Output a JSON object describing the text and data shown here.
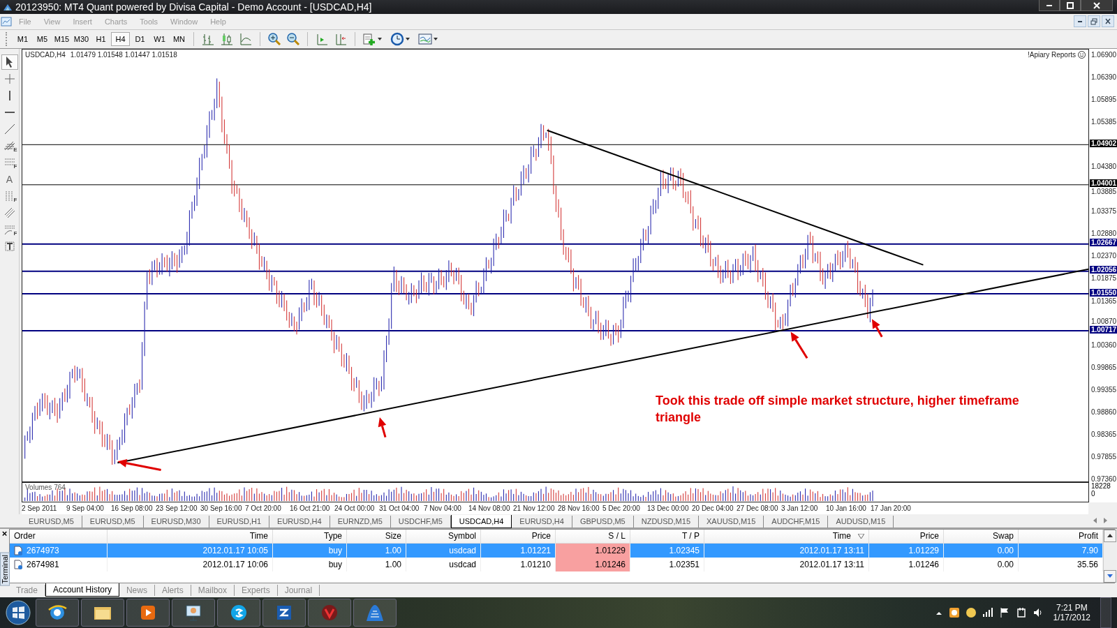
{
  "window": {
    "title": "20123950: MT4 Quant powered by Divisa Capital - Demo Account - [USDCAD,H4]"
  },
  "menu": [
    "File",
    "View",
    "Insert",
    "Charts",
    "Tools",
    "Window",
    "Help"
  ],
  "timeframes": [
    {
      "label": "M1",
      "selected": false
    },
    {
      "label": "M5",
      "selected": false
    },
    {
      "label": "M15",
      "selected": false
    },
    {
      "label": "M30",
      "selected": false
    },
    {
      "label": "H1",
      "selected": false
    },
    {
      "label": "H4",
      "selected": true
    },
    {
      "label": "D1",
      "selected": false
    },
    {
      "label": "W1",
      "selected": false
    },
    {
      "label": "MN",
      "selected": false
    }
  ],
  "drawing_tools": [
    {
      "kind": "cursor",
      "selected": true
    },
    {
      "kind": "crosshair",
      "selected": false
    },
    {
      "kind": "vline",
      "selected": false
    },
    {
      "kind": "hline",
      "selected": false
    },
    {
      "kind": "trend",
      "selected": false
    },
    {
      "kind": "fibo",
      "badge": "E",
      "selected": false
    },
    {
      "kind": "grid",
      "badge": "F",
      "selected": false
    },
    {
      "kind": "text",
      "glyph": "A",
      "selected": false
    },
    {
      "kind": "vgrid",
      "badge": "F",
      "selected": false
    },
    {
      "kind": "channel",
      "selected": false
    },
    {
      "kind": "fan",
      "badge": "F",
      "selected": false
    },
    {
      "kind": "label",
      "selected": false
    }
  ],
  "chart": {
    "symbol": "USDCAD,H4",
    "ohlc": "1.01479 1.01548 1.01447 1.01518",
    "indicator": "!Apiary Reports",
    "price_ticks": [
      "1.06900",
      "1.06390",
      "1.05895",
      "1.05385",
      "1.04380",
      "1.03885",
      "1.03375",
      "1.02880",
      "1.02370",
      "1.01875",
      "1.01365",
      "1.00870",
      "1.00360",
      "0.99865",
      "0.99355",
      "0.98860",
      "0.98365",
      "0.97855",
      "0.97360"
    ],
    "levels": [
      {
        "label": "1.04902",
        "color": "#000000"
      },
      {
        "label": "1.04001",
        "color": "#000000"
      },
      {
        "label": "1.02667",
        "color": "#000080"
      },
      {
        "label": "1.02056",
        "color": "#000080"
      },
      {
        "label": "1.01550",
        "color": "#000080"
      },
      {
        "label": "1.00717",
        "color": "#000080"
      }
    ],
    "annotation": "Took this trade off simple market structure, higher timeframe triangle",
    "volume_label": "Volumes 764",
    "volume_ticks": [
      "18228",
      "0"
    ],
    "dates": [
      "2 Sep 2011",
      "9 Sep 04:00",
      "16 Sep 08:00",
      "23 Sep 12:00",
      "30 Sep 16:00",
      "7 Oct 20:00",
      "16 Oct 21:00",
      "24 Oct 00:00",
      "31 Oct 04:00",
      "7 Nov 04:00",
      "14 Nov 08:00",
      "21 Nov 12:00",
      "28 Nov 16:00",
      "5 Dec 20:00",
      "13 Dec 00:00",
      "20 Dec 04:00",
      "27 Dec 08:00",
      "3 Jan 12:00",
      "10 Jan 16:00",
      "17 Jan 20:00"
    ]
  },
  "symbol_tabs": [
    {
      "label": "EURUSD,M5",
      "selected": false
    },
    {
      "label": "EURUSD,M5",
      "selected": false
    },
    {
      "label": "EURUSD,M30",
      "selected": false
    },
    {
      "label": "EURUSD,H1",
      "selected": false
    },
    {
      "label": "EURUSD,H4",
      "selected": false
    },
    {
      "label": "EURNZD,M5",
      "selected": false
    },
    {
      "label": "USDCHF,M5",
      "selected": false
    },
    {
      "label": "USDCAD,H4",
      "selected": true
    },
    {
      "label": "EURUSD,H4",
      "selected": false
    },
    {
      "label": "GBPUSD,M5",
      "selected": false
    },
    {
      "label": "NZDUSD,M15",
      "selected": false
    },
    {
      "label": "XAUUSD,M15",
      "selected": false
    },
    {
      "label": "AUDCHF,M15",
      "selected": false
    },
    {
      "label": "AUDUSD,M15",
      "selected": false
    }
  ],
  "terminal": {
    "close": "×",
    "side_label": "Terminal",
    "columns": [
      {
        "label": "Order",
        "sorted": false
      },
      {
        "label": "Time",
        "sorted": false
      },
      {
        "label": "Type",
        "sorted": false
      },
      {
        "label": "Size",
        "sorted": false
      },
      {
        "label": "Symbol",
        "sorted": false
      },
      {
        "label": "Price",
        "sorted": false
      },
      {
        "label": "S / L",
        "sorted": false
      },
      {
        "label": "T / P",
        "sorted": false
      },
      {
        "label": "Time",
        "sorted": true
      },
      {
        "label": "Price",
        "sorted": false
      },
      {
        "label": "Swap",
        "sorted": false
      },
      {
        "label": "Profit",
        "sorted": false
      }
    ],
    "rows": [
      {
        "selected": true,
        "cells": [
          "2674973",
          "2012.01.17 10:05",
          "buy",
          "1.00",
          "usdcad",
          "1.01221",
          "1.01229",
          "1.02345",
          "2012.01.17 13:11",
          "1.01229",
          "0.00",
          "7.90"
        ]
      },
      {
        "selected": false,
        "cells": [
          "2674981",
          "2012.01.17 10:06",
          "buy",
          "1.00",
          "usdcad",
          "1.01210",
          "1.01246",
          "1.02351",
          "2012.01.17 13:11",
          "1.01246",
          "0.00",
          "35.56"
        ]
      }
    ],
    "tabs": [
      {
        "label": "Trade",
        "selected": false
      },
      {
        "label": "Account History",
        "selected": true
      },
      {
        "label": "News",
        "selected": false
      },
      {
        "label": "Alerts",
        "selected": false
      },
      {
        "label": "Mailbox",
        "selected": false
      },
      {
        "label": "Experts",
        "selected": false
      },
      {
        "label": "Journal",
        "selected": false
      }
    ]
  },
  "taskbar": {
    "time": "7:21 PM",
    "date": "1/17/2012"
  }
}
